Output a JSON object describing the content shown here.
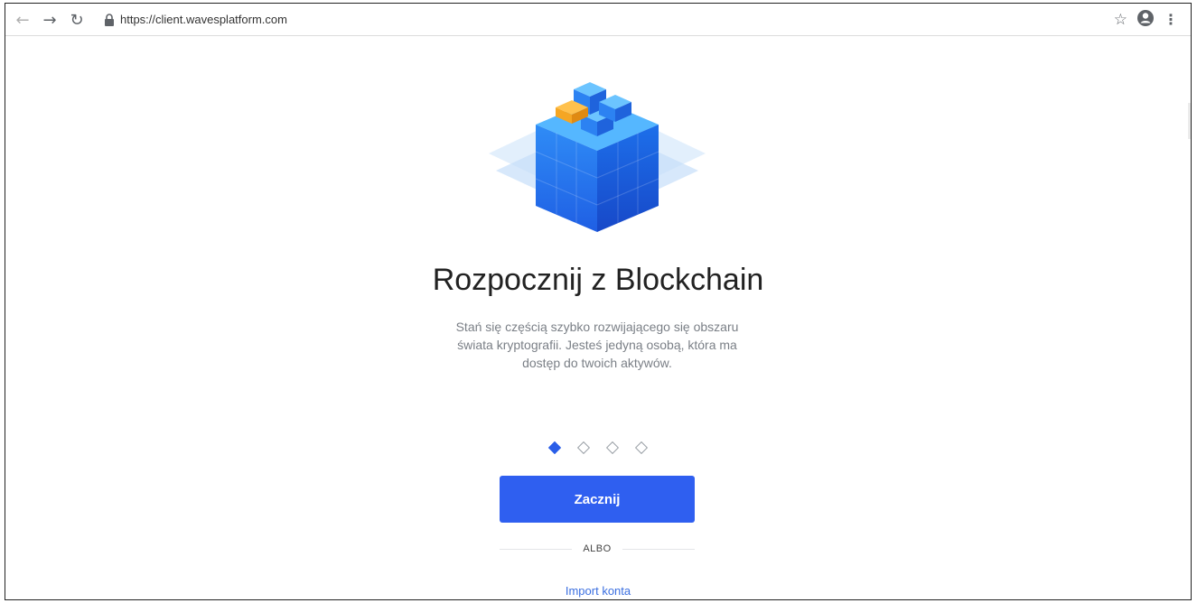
{
  "browser": {
    "url": "https://client.wavesplatform.com",
    "icons": [
      "back-arrow-icon",
      "forward-arrow-icon",
      "reload-icon",
      "lock-icon",
      "star-icon",
      "profile-icon",
      "menu-icon"
    ]
  },
  "page": {
    "title": "Rozpocznij z Blockchain",
    "description": "Stań się częścią szybko rozwijającego się obszaru świata kryptografii. Jesteś jedyną osobą, która ma dostęp do twoich aktywów.",
    "carousel": {
      "total": 4,
      "active": 1
    },
    "start_button": "Zacznij",
    "divider_text": "ALBO",
    "import_link": "Import konta"
  },
  "colors": {
    "primary": "#2f5ff0",
    "link": "#3b6fe0",
    "title": "#222222",
    "description": "#7a7f86",
    "hero_accent": "#f5a623"
  }
}
